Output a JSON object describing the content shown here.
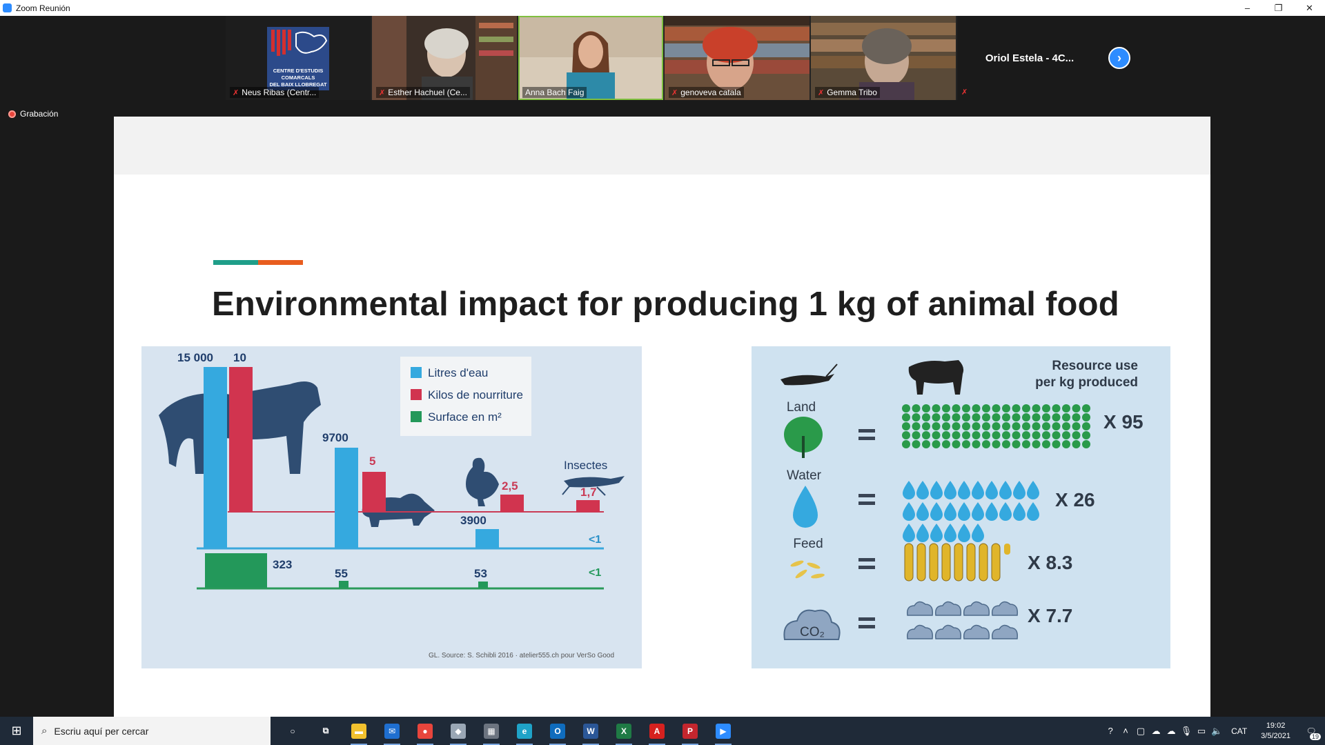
{
  "window": {
    "title": "Zoom Reunión",
    "controls": [
      "–",
      "❐",
      "✕"
    ]
  },
  "participants": [
    {
      "name": "Neus Ribas (Centr...",
      "muted": true,
      "kind": "logo",
      "logo_text": [
        "CENTRE D'ESTUDIS",
        "COMARCALS",
        "DEL BAIX LLOBREGAT"
      ]
    },
    {
      "name": "Esther Hachuel (Ce...",
      "muted": true,
      "kind": "video"
    },
    {
      "name": "Anna Bach Faig",
      "muted": false,
      "kind": "video",
      "active": true
    },
    {
      "name": "genoveva catala",
      "muted": true,
      "kind": "video"
    },
    {
      "name": "Gemma Tribo",
      "muted": true,
      "kind": "video"
    },
    {
      "name": "Oriol Estela - 4C...",
      "muted": true,
      "kind": "name"
    }
  ],
  "recording": {
    "label": "Grabación"
  },
  "slide": {
    "title": "Environmental impact for producing 1 kg of animal food",
    "left_chart": {
      "legend": [
        "Litres d'eau",
        "Kilos de nourriture",
        "Surface en m²"
      ],
      "labels": {
        "cow_water": "15 000",
        "cow_food": "10",
        "cow_surface": "323",
        "pig_water": "9700",
        "pig_food": "5",
        "pig_surface": "55",
        "chicken_water": "3900",
        "chicken_food": "2,5",
        "chicken_surface": "53",
        "insect_title": "Insectes",
        "insect_food": "1,7",
        "insect_water": "<1",
        "insect_surface": "<1"
      },
      "source": "GL. Source: S. Schibli 2016 · atelier555.ch pour VerSo Good"
    },
    "right_panel": {
      "header": [
        "Resource use",
        "per kg produced"
      ],
      "rows": [
        {
          "label": "Land",
          "multiplier": "X 95"
        },
        {
          "label": "Water",
          "multiplier": "X 26"
        },
        {
          "label": "Feed",
          "multiplier": "X 8.3"
        },
        {
          "label": "CO₂",
          "multiplier": "X 7.7"
        }
      ]
    }
  },
  "taskbar": {
    "search_placeholder": "Escriu aquí per cercar",
    "apps": [
      {
        "name": "cortana",
        "glyph": "○",
        "color": "transparent"
      },
      {
        "name": "task-view",
        "glyph": "⧉",
        "color": "transparent"
      },
      {
        "name": "file-explorer",
        "glyph": "▬",
        "color": "#f2c12e"
      },
      {
        "name": "mail",
        "glyph": "✉",
        "color": "#1f6fd0"
      },
      {
        "name": "chrome",
        "glyph": "●",
        "color": "#e8453c"
      },
      {
        "name": "app-generic",
        "glyph": "◆",
        "color": "#9aa7b5"
      },
      {
        "name": "calculator",
        "glyph": "▦",
        "color": "#6c7480"
      },
      {
        "name": "edge",
        "glyph": "e",
        "color": "#1fa3c8"
      },
      {
        "name": "outlook",
        "glyph": "O",
        "color": "#0f6cbd"
      },
      {
        "name": "word",
        "glyph": "W",
        "color": "#2b5797"
      },
      {
        "name": "excel",
        "glyph": "X",
        "color": "#1f7a45"
      },
      {
        "name": "acrobat",
        "glyph": "A",
        "color": "#d6211f"
      },
      {
        "name": "pdf-editor",
        "glyph": "P",
        "color": "#c4262e"
      },
      {
        "name": "zoom",
        "glyph": "▶",
        "color": "#2d8cff"
      }
    ],
    "language": "CAT",
    "time": "19:02",
    "date": "3/5/2021",
    "notifications": "19"
  }
}
